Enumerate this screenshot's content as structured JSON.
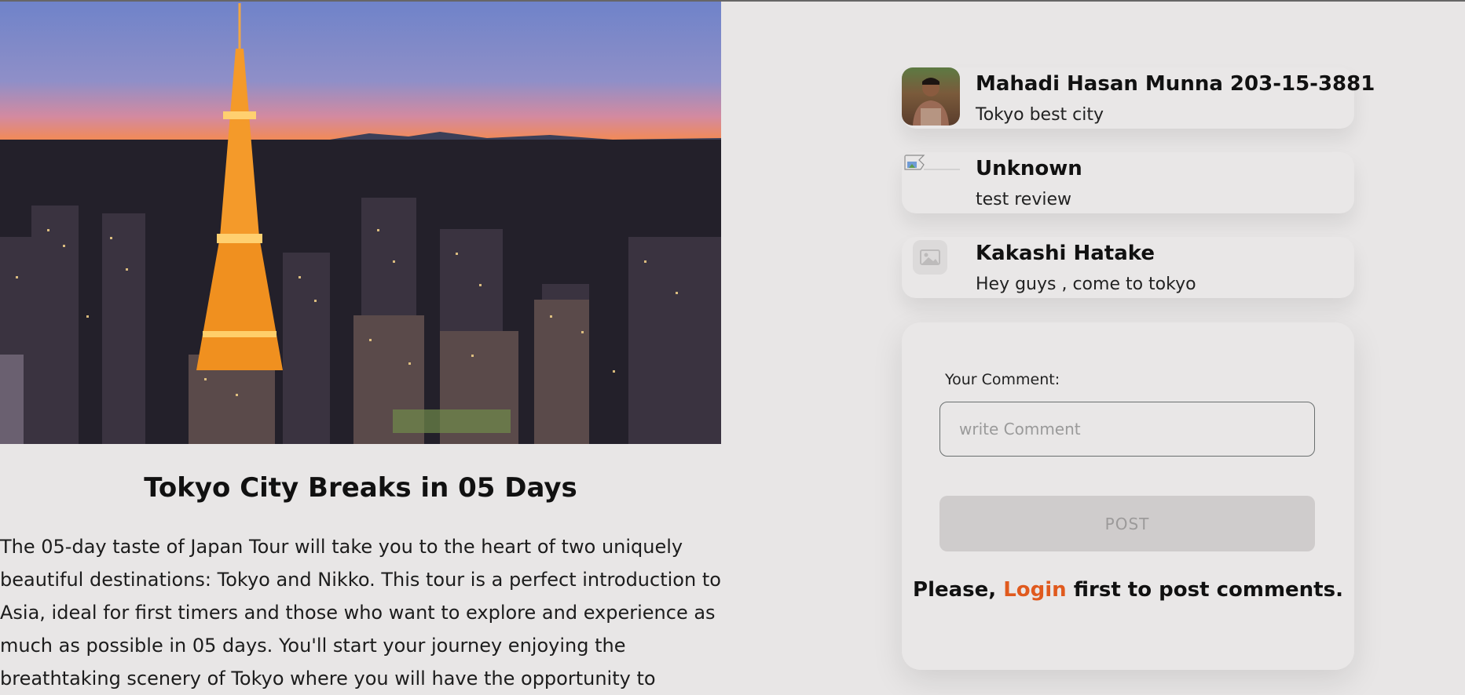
{
  "trip": {
    "title": "Tokyo City Breaks in 05 Days",
    "description": "The 05-day taste of Japan Tour will take you to the heart of two uniquely beautiful destinations: Tokyo and Nikko. This tour is a perfect introduction to Asia, ideal for first timers and those who want to explore and experience as much as possible in 05 days. You'll start your journey enjoying the breathtaking scenery of Tokyo where you will have the opportunity to"
  },
  "reviews": [
    {
      "name": "Mahadi Hasan Munna 203-15-3881",
      "text": "Tokyo best city"
    },
    {
      "name": "Unknown",
      "text": "test review"
    },
    {
      "name": "Kakashi Hatake",
      "text": "Hey guys , come to tokyo"
    }
  ],
  "comment_form": {
    "label": "Your Comment:",
    "placeholder": "write Comment",
    "value": "",
    "post_label": "POST",
    "login_prefix": "Please,",
    "login_link": "Login",
    "login_suffix": "first to post comments."
  },
  "colors": {
    "background": "#e8e6e6",
    "accent": "#e05a1e",
    "button_disabled": "#cfcccc"
  }
}
